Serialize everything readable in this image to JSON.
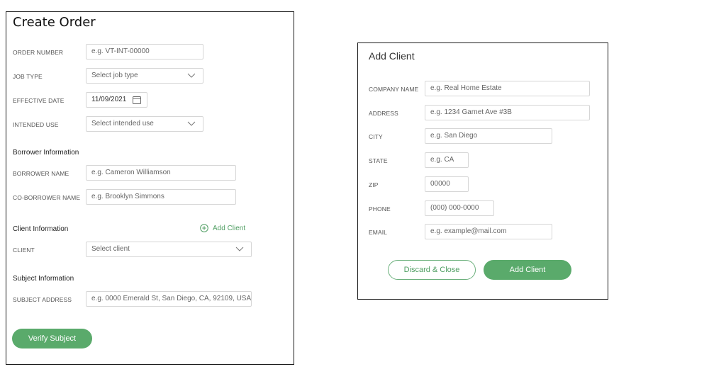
{
  "create_order": {
    "title": "Create Order",
    "order_number": {
      "label": "ORDER NUMBER",
      "placeholder": "e.g. VT-INT-00000"
    },
    "job_type": {
      "label": "JOB TYPE",
      "placeholder": "Select job type"
    },
    "effective_date": {
      "label": "EFFECTIVE DATE",
      "value": "11/09/2021"
    },
    "intended_use": {
      "label": "INTENDED USE",
      "placeholder": "Select intended use"
    },
    "borrower_section": "Borrower Information",
    "borrower_name": {
      "label": "BORROWER NAME",
      "placeholder": "e.g. Cameron Williamson"
    },
    "co_borrower_name": {
      "label": "CO-BORROWER NAME",
      "placeholder": "e.g. Brooklyn Simmons"
    },
    "client_section": "Client Information",
    "add_client_link": "Add Client",
    "client": {
      "label": "CLIENT",
      "placeholder": "Select client"
    },
    "subject_section": "Subject Information",
    "subject_address": {
      "label": "SUBJECT ADDRESS",
      "placeholder": "e.g. 0000 Emerald St, San Diego, CA, 92109, USA"
    },
    "verify_button": "Verify Subject"
  },
  "add_client": {
    "title": "Add Client",
    "company_name": {
      "label": "COMPANY NAME",
      "placeholder": "e.g. Real Home Estate"
    },
    "address": {
      "label": "ADDRESS",
      "placeholder": "e.g. 1234 Garnet Ave #3B"
    },
    "city": {
      "label": "CITY",
      "placeholder": "e.g. San Diego"
    },
    "state": {
      "label": "STATE",
      "placeholder": "e.g. CA"
    },
    "zip": {
      "label": "ZIP",
      "placeholder": "00000"
    },
    "phone": {
      "label": "PHONE",
      "placeholder": "(000) 000-0000"
    },
    "email": {
      "label": "EMAIL",
      "placeholder": "e.g. example@mail.com"
    },
    "discard_button": "Discard & Close",
    "add_button": "Add Client"
  },
  "colors": {
    "accent": "#5aaa6b",
    "border": "#d6d6d6",
    "panel_border": "#1a1a1a"
  },
  "icons": {
    "dropdown": "chevron-down-icon",
    "calendar": "calendar-icon",
    "add": "plus-circle-icon"
  }
}
